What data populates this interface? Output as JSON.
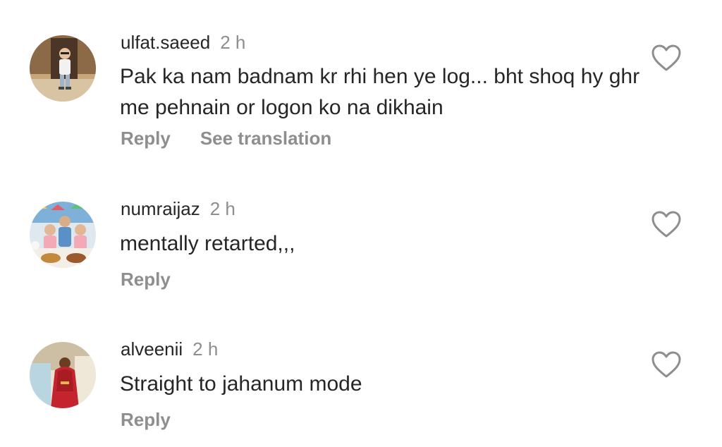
{
  "comments": [
    {
      "username": "ulfat.saeed",
      "time": "2 h",
      "text": "Pak ka nam badnam kr rhi hen ye log... bht shoq hy ghr me pehnain or logon ko na dikhain",
      "reply_label": "Reply",
      "translate_label": "See translation",
      "avatar_icon": "avatar-child-standing",
      "like_icon": "heart-outline-icon"
    },
    {
      "username": "numraijaz",
      "time": "2 h",
      "text": "mentally retarted,,,",
      "reply_label": "Reply",
      "avatar_icon": "avatar-three-children",
      "like_icon": "heart-outline-icon"
    },
    {
      "username": "alveenii",
      "time": "2 h",
      "text": "Straight to jahanum mode",
      "reply_label": "Reply",
      "avatar_icon": "avatar-woman-red-dress",
      "like_icon": "heart-outline-icon"
    }
  ],
  "colors": {
    "primary_text": "#262626",
    "secondary_text": "#8e8e8e",
    "background": "#ffffff"
  }
}
